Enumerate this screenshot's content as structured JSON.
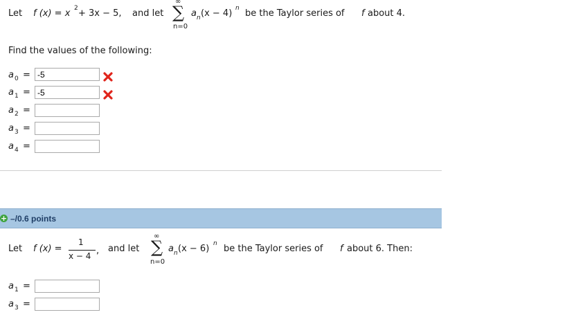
{
  "problem1": {
    "intro_let": "Let",
    "f_def": "f (x) = x",
    "f_exp": "2",
    "f_rest": " + 3x − 5,",
    "and_let": "and let",
    "sum_top": "∞",
    "sum_sym": "∑",
    "sum_bottom": "n=0",
    "term_a": "a",
    "term_sub": "n",
    "term_x": "(x − 4)",
    "term_exp": "n",
    "tail": "be the Taylor series of",
    "tail_f": "f",
    "tail_end": "about 4.",
    "instruction": "Find the values of the following:",
    "answers": [
      {
        "var": "a",
        "sub": "0",
        "eq": "=",
        "value": "-5",
        "status": "incorrect"
      },
      {
        "var": "a",
        "sub": "1",
        "eq": "=",
        "value": "-5",
        "status": "incorrect"
      },
      {
        "var": "a",
        "sub": "2",
        "eq": "=",
        "value": "",
        "status": "none"
      },
      {
        "var": "a",
        "sub": "3",
        "eq": "=",
        "value": "",
        "status": "none"
      },
      {
        "var": "a",
        "sub": "4",
        "eq": "=",
        "value": "",
        "status": "none"
      }
    ]
  },
  "problem2": {
    "points_label": "–/0.6 points",
    "intro_let": "Let",
    "f_def": "f (x) =",
    "frac_num": "1",
    "frac_den": "x − 4",
    "frac_comma": ",",
    "and_let": "and let",
    "sum_top": "∞",
    "sum_sym": "∑",
    "sum_bottom": "n=0",
    "term_a": "a",
    "term_sub": "n",
    "term_x": "(x − 6)",
    "term_exp": "n",
    "tail": "be the Taylor series of",
    "tail_f": "f",
    "tail_end": "about 6. Then:",
    "answers": [
      {
        "var": "a",
        "sub": "1",
        "eq": "=",
        "value": ""
      },
      {
        "var": "a",
        "sub": "3",
        "eq": "=",
        "value": ""
      }
    ]
  },
  "colors": {
    "incorrect_mark": "#e0241b",
    "points_bar": "#a6c6e2",
    "points_text": "#1f3e66",
    "expand_icon": "#3fa33f"
  },
  "icons": {
    "incorrect": "x-mark-icon",
    "expand": "plus-circle-icon"
  }
}
